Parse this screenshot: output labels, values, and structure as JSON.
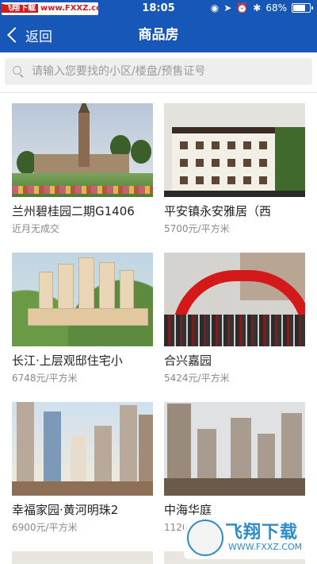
{
  "status_bar": {
    "watermark_left": "飞翔下载",
    "watermark_url": "www.FXXZ.com",
    "time": "18:05",
    "battery": "68%"
  },
  "nav": {
    "back_label": "返回",
    "title": "商品房"
  },
  "search": {
    "placeholder": "请输入您要找的小区/楼盘/预售证号"
  },
  "listings": [
    {
      "name": "兰州碧桂园二期G1406",
      "price": "近月无成交"
    },
    {
      "name": "平安镇永安雅居（西",
      "price": "5700元/平方米"
    },
    {
      "name": "长江·上层观邸住宅小",
      "price": "6748元/平方米"
    },
    {
      "name": "合兴嘉园",
      "price": "5424元/平方米"
    },
    {
      "name": "幸福家园·黄河明珠2",
      "price": "6900元/平方米"
    },
    {
      "name": "中海华庭",
      "price": "1120"
    }
  ],
  "watermark": {
    "brand": "飞翔下载",
    "url": "WWW.FXXZ.COM"
  },
  "colors": {
    "primary": "#1757b8",
    "watermark_blue": "#2d8bc8"
  }
}
